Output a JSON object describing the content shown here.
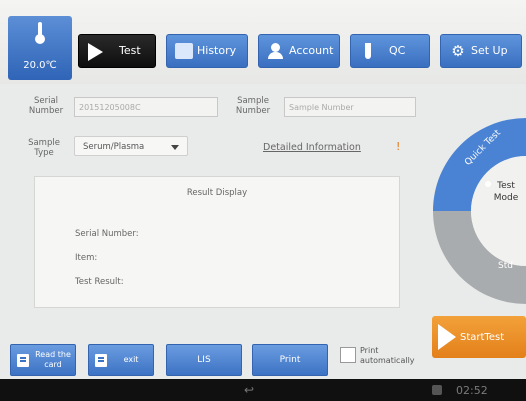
{
  "status": {
    "temperature": "20.0℃",
    "clock": "02:52"
  },
  "tabs": [
    {
      "label": "Test",
      "icon": "play-icon"
    },
    {
      "label": "History",
      "icon": "document-icon"
    },
    {
      "label": "Account",
      "icon": "person-icon"
    },
    {
      "label": "QC",
      "icon": "test-tube-icon"
    },
    {
      "label": "Set Up",
      "icon": "gear-icon"
    }
  ],
  "form": {
    "serial_label_1": "Serial",
    "serial_label_2": "Number",
    "serial_value": "20151205008C",
    "sample_label_1": "Sample",
    "sample_label_2": "Number",
    "sample_placeholder": "Sample Number",
    "type_label_1": "Sample",
    "type_label_2": "Type",
    "type_value": "Serum/Plasma",
    "detailed_link": "Detailed Information",
    "detailed_mark": "!"
  },
  "result": {
    "title": "Result Display",
    "serial": "Serial Number:",
    "item": "Item:",
    "test_result": "Test Result:"
  },
  "mode": {
    "quick": "Quick Test",
    "center_1": "Test",
    "center_2": "Mode",
    "std": "Std"
  },
  "start_label": "StartTest",
  "bottom": {
    "read_card_1": "Read the",
    "read_card_2": "card",
    "exit": "exit",
    "lis": "LIS",
    "print": "Print",
    "auto_1": "Print",
    "auto_2": "automatically"
  },
  "colors": {
    "tab_blue": "#3a6fc0",
    "active_tab": "#111111",
    "start_orange": "#e3801a",
    "dial_blue": "#4a82d4"
  }
}
